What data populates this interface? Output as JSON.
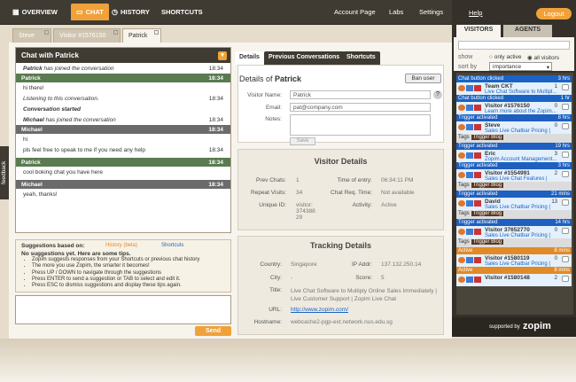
{
  "nav": {
    "overview": "OVERVIEW",
    "chat": "CHAT",
    "history": "HISTORY",
    "shortcuts": "SHORTCUTS",
    "account": "Account Page",
    "labs": "Labs",
    "settings": "Settings",
    "help": "Help",
    "logout": "Logout"
  },
  "chat_tabs": [
    "Steve",
    "Visitor #1576150",
    "Patrick"
  ],
  "chat": {
    "title": "Chat with Patrick",
    "m1": "Patrick has joined the conversation",
    "t1": "18:34",
    "m2h": "Patrick",
    "t2": "18:34",
    "m2": "hi there!",
    "m3": "Listening to this conversation.",
    "t3": "18:34",
    "m4": "Conversation started",
    "m5": "Michael has joined the conversation",
    "t5": "18:34",
    "m6h": "Michael",
    "t6": "18:34",
    "m6": "hi",
    "m7": "pls feel free to speak to me if you need any help",
    "t7": "18:34",
    "m8h": "Patrick",
    "t8": "18:34",
    "m8": "cool boking chat you have here",
    "m9h": "Michael",
    "t9": "18:34",
    "m9": "yeah, thanks!"
  },
  "sugg": {
    "based": "Suggestions based on:",
    "history": "History (beta)",
    "shortcuts": "Shortcuts",
    "head": "No suggestions yet. Here are some tips.",
    "tips": [
      "Zopim suggests responses from your Shortcuts or previous chat history",
      "The more you use Zopim, the smarter it becomes!",
      "Press UP / DOWN to navigate through the suggestions",
      "Press ENTER to send a suggestion or TAB to select and edit it.",
      "Press ESC to dismiss suggestions and display these tips again."
    ]
  },
  "send": "Send",
  "right": {
    "tab_details": "Details",
    "tab_prev": "Previous Conversations",
    "tab_short": "Shortcuts",
    "details_of": "Details of",
    "name": "Patrick",
    "ban": "Ban user",
    "vname_l": "Visitor Name:",
    "vname": "Patrick",
    "email_l": "Email:",
    "email": "pat@company.com",
    "notes_l": "Notes:",
    "save": "Save",
    "vd_title": "Visitor Details",
    "prev_l": "Prev Chats:",
    "prev": "1",
    "toe_l": "Time of entry:",
    "toe": "06:34:11 PM",
    "rv_l": "Repeat Visits:",
    "rv": "34",
    "crt_l": "Chat Req. Time:",
    "crt": "Not available",
    "uid_l": "Unique ID:",
    "uid": "visitor: 374388 29",
    "act_l": "Activity:",
    "act": "Active",
    "td_title": "Tracking Details",
    "country_l": "Country:",
    "country": "Singapore",
    "ip_l": "IP Addr:",
    "ip": "137.132.250.14",
    "city_l": "City:",
    "city": "-",
    "score_l": "Score:",
    "score": "5",
    "title_l": "Title:",
    "title": "Live Chat Software to Multiply Online Sales Immediately | Live Customer Support | Zopim Live Chat",
    "url_l": "URL:",
    "url": "http://www.zopim.com/",
    "host_l": "Hostname:",
    "host": "webcache2-pgp-ext.network.nus.edu.sg"
  },
  "visitors": {
    "tab1": "VISITORS",
    "tab2": "AGENTS",
    "show": "show",
    "only": "only active",
    "all": "all visitors",
    "sort": "sort by",
    "importance": "importance",
    "supported": "supported by",
    "brand": "zopim",
    "items": [
      {
        "h": "Chat button clicked",
        "time": "3 hrs",
        "name": "Team CKT",
        "n": "1",
        "desc": "Live Chat Software to Multipl..."
      },
      {
        "h": "Chat button clicked",
        "time": "1 hr",
        "name": "Visitor #1576150",
        "n": "0",
        "desc": "Learn more about the Zopim..."
      },
      {
        "h": "Trigger activated",
        "time": "8 hrs",
        "name": "Steve",
        "n": "0",
        "desc": "Sales Live Chatbar Pricing |",
        "tag": "Trigger Blog"
      },
      {
        "h": "Trigger activated",
        "time": "19 hrs",
        "name": "Eric",
        "n": "3",
        "desc": "Zopim Account Management..."
      },
      {
        "h": "Trigger activated",
        "time": "3 hrs",
        "name": "Visitor #1554991",
        "n": "2",
        "desc": "Sales Live Chat Features |",
        "tag": "Trigger Blog"
      },
      {
        "h": "Trigger activated",
        "time": "21 mins",
        "name": "David",
        "n": "13",
        "desc": "Sales Live Chatbar Pricing |",
        "tag": "Trigger Blog"
      },
      {
        "h": "Trigger activated",
        "time": "14 hrs",
        "name": "Visitor 37652770",
        "n": "0",
        "desc": "Sales Live Chatbar Pricing |",
        "tag": "Trigger Blog"
      },
      {
        "h": "Active",
        "time": "8 mins",
        "name": "Visitor #1580119",
        "n": "0",
        "desc": "Sales Live Chatbar Pricing |"
      },
      {
        "h": "Active",
        "time": "8 mins",
        "name": "Visitor #1580148",
        "n": "2"
      }
    ],
    "tags_label": "Tags"
  },
  "feedback": "feedback"
}
